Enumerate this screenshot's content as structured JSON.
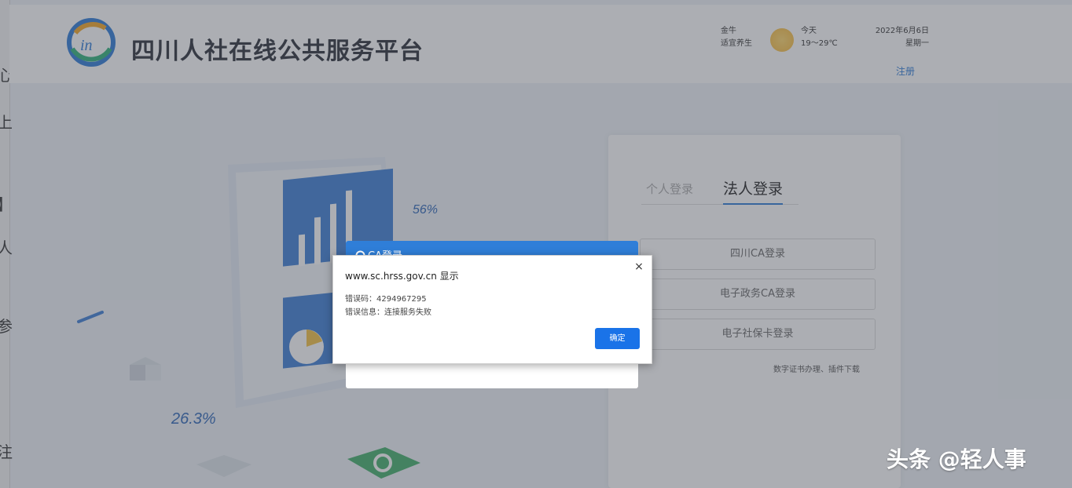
{
  "header": {
    "site_title": "四川人社在线公共服务平台",
    "weather_loc": "金牛",
    "weather_desc": "适宜养生",
    "weather_day": "今天",
    "weather_temp": "19～29℃",
    "date": "2022年6月6日",
    "weekday": "星期一",
    "register": "注册"
  },
  "illustration": {
    "stat_top": "56%",
    "stat_bottom": "26.3%"
  },
  "login": {
    "tabs": [
      "个人登录",
      "法人登录"
    ],
    "active_tab": "法人登录",
    "buttons": [
      "四川CA登录",
      "电子政务CA登录",
      "电子社保卡登录"
    ],
    "cert_link": "数字证书办理、插件下载"
  },
  "ca_dialog": {
    "title": "CA登录"
  },
  "alert": {
    "title": "www.sc.hrss.gov.cn 显示",
    "error_code_line": "错误码：4294967295",
    "error_msg_line": "错误信息：连接服务失败",
    "ok_label": "确定",
    "close_glyph": "×"
  },
  "watermark": "头条 @轻人事",
  "colors": {
    "accent": "#2f7ed8",
    "ok_button": "#1a73e8"
  }
}
